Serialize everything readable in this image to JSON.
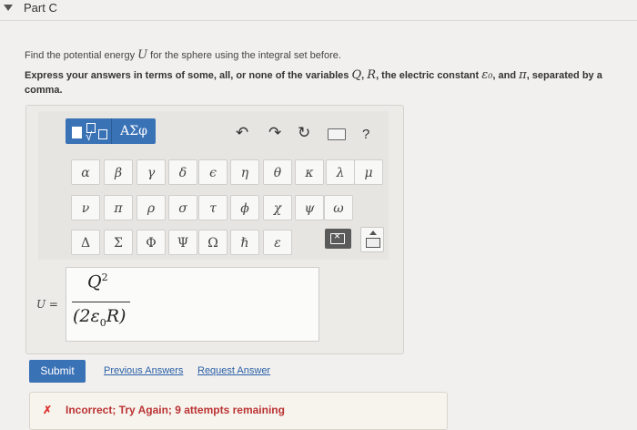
{
  "header": {
    "part_title": "Part C"
  },
  "question": {
    "text_pre": "Find the potential energy ",
    "var_u": "U",
    "text_post": " for the sphere using the integral set before.",
    "instr_pre": "Express your answers in terms of some, all, or none of the variables ",
    "var_q": "Q",
    "comma": ", ",
    "var_r": "R",
    "instr_mid": ", the electric constant ",
    "var_eps": "ε₀",
    "instr_and": ", and ",
    "var_pi": "π",
    "instr_post": ", separated by a comma."
  },
  "toolbar": {
    "greek_label": "ΑΣφ",
    "undo": "↶",
    "redo": "↷",
    "reset": "↻",
    "help": "?"
  },
  "keys": {
    "row1": [
      "α",
      "β",
      "γ",
      "δ",
      "ϵ",
      "η",
      "θ",
      "κ",
      "λ",
      "μ"
    ],
    "row2": [
      "ν",
      "π",
      "ρ",
      "σ",
      "τ",
      "ϕ",
      "χ",
      "ψ",
      "ω"
    ],
    "row3": [
      "Δ",
      "Σ",
      "Φ",
      "Ψ",
      "Ω",
      "ℏ",
      "ε"
    ]
  },
  "answer": {
    "label": "U =",
    "numerator": "Q",
    "numerator_exp": "2",
    "den_open": "(2ε",
    "den_sub": "0",
    "den_close": "R)"
  },
  "actions": {
    "submit": "Submit",
    "previous": "Previous Answers",
    "request": "Request Answer"
  },
  "feedback": {
    "icon": "✗",
    "text": "Incorrect; Try Again; 9 attempts remaining"
  }
}
